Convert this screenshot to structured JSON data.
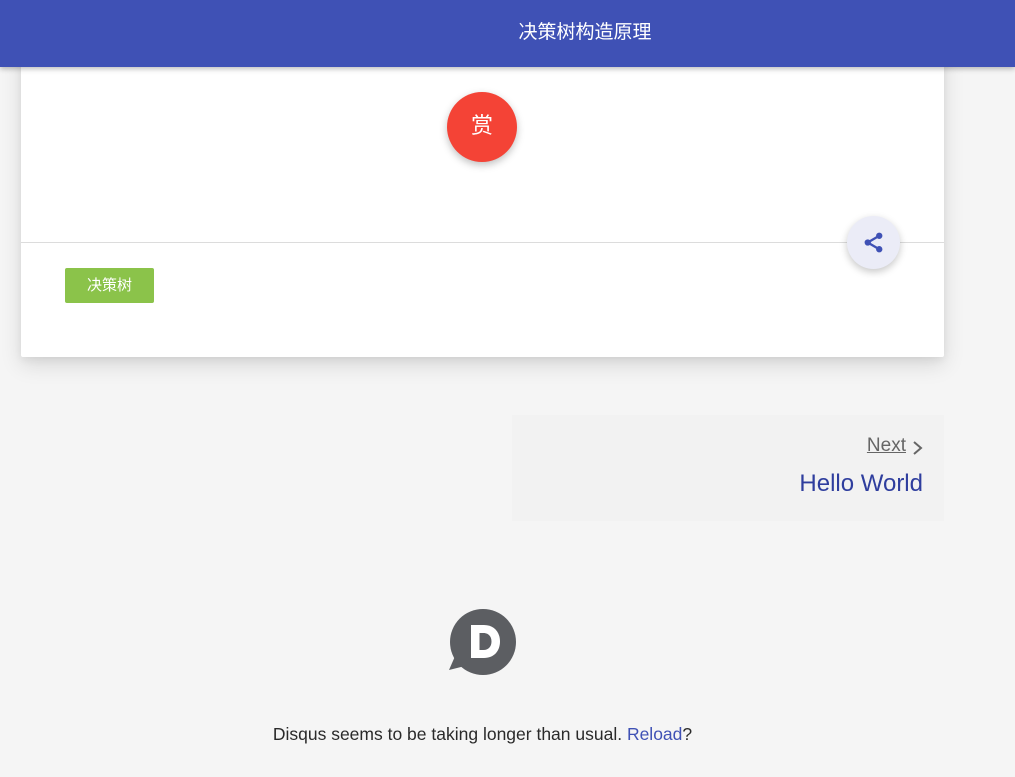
{
  "header": {
    "title": "决策树构造原理"
  },
  "post": {
    "reward_label": "赏",
    "share_icon": "share-icon",
    "tags": [
      {
        "label": "决策树"
      }
    ]
  },
  "pagination": {
    "next_label": "Next",
    "next_title": "Hello World"
  },
  "disqus": {
    "logo_icon": "disqus-logo",
    "message_prefix": "Disqus seems to be taking longer than usual. ",
    "reload_label": "Reload",
    "message_suffix": "?"
  },
  "colors": {
    "header_bg": "#3f51b5",
    "reward_bg": "#f44336",
    "tag_bg": "#8bc34a",
    "link": "#3f51b5"
  }
}
